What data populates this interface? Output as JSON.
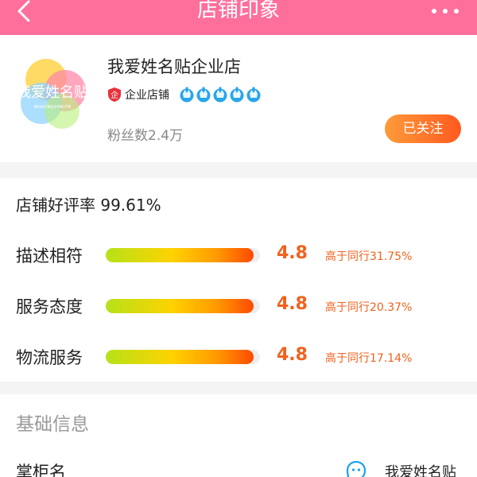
{
  "navbar": {
    "title": "店铺印象",
    "back_icon": "chevron-left-icon",
    "more_icon": "more-dots-icon",
    "bg_color": "#ff6f9c"
  },
  "shop": {
    "name": "我爱姓名贴企业店",
    "logo_text": "我爱姓名贴",
    "logo_subtext": "WOAIXINGMINGTIE",
    "enterprise_badge": "企业店铺",
    "crown_count": 5,
    "fans": "粉丝数2.4万",
    "follow_label": "已关注"
  },
  "ratings": {
    "good_rate": "店铺好评率 99.61%",
    "items": [
      {
        "label": "描述相符",
        "score": "4.8",
        "fill_fraction": 0.96,
        "compare": "高于同行31.75%"
      },
      {
        "label": "服务态度",
        "score": "4.8",
        "fill_fraction": 0.96,
        "compare": "高于同行20.37%"
      },
      {
        "label": "物流服务",
        "score": "4.8",
        "fill_fraction": 0.96,
        "compare": "高于同行17.14%"
      }
    ],
    "accent_color": "#f0621e"
  },
  "basic_info": {
    "title": "基础信息",
    "owner_label": "掌柜名",
    "owner_icon": "wangwang-chat-icon",
    "owner_name": "我爱姓名贴"
  }
}
